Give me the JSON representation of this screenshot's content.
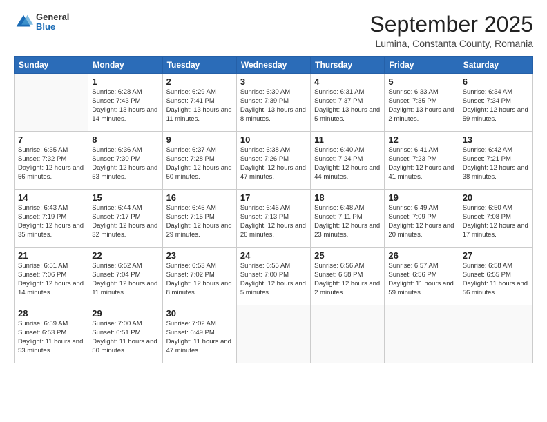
{
  "header": {
    "logo": {
      "general": "General",
      "blue": "Blue"
    },
    "title": "September 2025",
    "location": "Lumina, Constanta County, Romania"
  },
  "weekdays": [
    "Sunday",
    "Monday",
    "Tuesday",
    "Wednesday",
    "Thursday",
    "Friday",
    "Saturday"
  ],
  "weeks": [
    [
      {
        "day": "",
        "info": ""
      },
      {
        "day": "1",
        "info": "Sunrise: 6:28 AM\nSunset: 7:43 PM\nDaylight: 13 hours\nand 14 minutes."
      },
      {
        "day": "2",
        "info": "Sunrise: 6:29 AM\nSunset: 7:41 PM\nDaylight: 13 hours\nand 11 minutes."
      },
      {
        "day": "3",
        "info": "Sunrise: 6:30 AM\nSunset: 7:39 PM\nDaylight: 13 hours\nand 8 minutes."
      },
      {
        "day": "4",
        "info": "Sunrise: 6:31 AM\nSunset: 7:37 PM\nDaylight: 13 hours\nand 5 minutes."
      },
      {
        "day": "5",
        "info": "Sunrise: 6:33 AM\nSunset: 7:35 PM\nDaylight: 13 hours\nand 2 minutes."
      },
      {
        "day": "6",
        "info": "Sunrise: 6:34 AM\nSunset: 7:34 PM\nDaylight: 12 hours\nand 59 minutes."
      }
    ],
    [
      {
        "day": "7",
        "info": "Sunrise: 6:35 AM\nSunset: 7:32 PM\nDaylight: 12 hours\nand 56 minutes."
      },
      {
        "day": "8",
        "info": "Sunrise: 6:36 AM\nSunset: 7:30 PM\nDaylight: 12 hours\nand 53 minutes."
      },
      {
        "day": "9",
        "info": "Sunrise: 6:37 AM\nSunset: 7:28 PM\nDaylight: 12 hours\nand 50 minutes."
      },
      {
        "day": "10",
        "info": "Sunrise: 6:38 AM\nSunset: 7:26 PM\nDaylight: 12 hours\nand 47 minutes."
      },
      {
        "day": "11",
        "info": "Sunrise: 6:40 AM\nSunset: 7:24 PM\nDaylight: 12 hours\nand 44 minutes."
      },
      {
        "day": "12",
        "info": "Sunrise: 6:41 AM\nSunset: 7:23 PM\nDaylight: 12 hours\nand 41 minutes."
      },
      {
        "day": "13",
        "info": "Sunrise: 6:42 AM\nSunset: 7:21 PM\nDaylight: 12 hours\nand 38 minutes."
      }
    ],
    [
      {
        "day": "14",
        "info": "Sunrise: 6:43 AM\nSunset: 7:19 PM\nDaylight: 12 hours\nand 35 minutes."
      },
      {
        "day": "15",
        "info": "Sunrise: 6:44 AM\nSunset: 7:17 PM\nDaylight: 12 hours\nand 32 minutes."
      },
      {
        "day": "16",
        "info": "Sunrise: 6:45 AM\nSunset: 7:15 PM\nDaylight: 12 hours\nand 29 minutes."
      },
      {
        "day": "17",
        "info": "Sunrise: 6:46 AM\nSunset: 7:13 PM\nDaylight: 12 hours\nand 26 minutes."
      },
      {
        "day": "18",
        "info": "Sunrise: 6:48 AM\nSunset: 7:11 PM\nDaylight: 12 hours\nand 23 minutes."
      },
      {
        "day": "19",
        "info": "Sunrise: 6:49 AM\nSunset: 7:09 PM\nDaylight: 12 hours\nand 20 minutes."
      },
      {
        "day": "20",
        "info": "Sunrise: 6:50 AM\nSunset: 7:08 PM\nDaylight: 12 hours\nand 17 minutes."
      }
    ],
    [
      {
        "day": "21",
        "info": "Sunrise: 6:51 AM\nSunset: 7:06 PM\nDaylight: 12 hours\nand 14 minutes."
      },
      {
        "day": "22",
        "info": "Sunrise: 6:52 AM\nSunset: 7:04 PM\nDaylight: 12 hours\nand 11 minutes."
      },
      {
        "day": "23",
        "info": "Sunrise: 6:53 AM\nSunset: 7:02 PM\nDaylight: 12 hours\nand 8 minutes."
      },
      {
        "day": "24",
        "info": "Sunrise: 6:55 AM\nSunset: 7:00 PM\nDaylight: 12 hours\nand 5 minutes."
      },
      {
        "day": "25",
        "info": "Sunrise: 6:56 AM\nSunset: 6:58 PM\nDaylight: 12 hours\nand 2 minutes."
      },
      {
        "day": "26",
        "info": "Sunrise: 6:57 AM\nSunset: 6:56 PM\nDaylight: 11 hours\nand 59 minutes."
      },
      {
        "day": "27",
        "info": "Sunrise: 6:58 AM\nSunset: 6:55 PM\nDaylight: 11 hours\nand 56 minutes."
      }
    ],
    [
      {
        "day": "28",
        "info": "Sunrise: 6:59 AM\nSunset: 6:53 PM\nDaylight: 11 hours\nand 53 minutes."
      },
      {
        "day": "29",
        "info": "Sunrise: 7:00 AM\nSunset: 6:51 PM\nDaylight: 11 hours\nand 50 minutes."
      },
      {
        "day": "30",
        "info": "Sunrise: 7:02 AM\nSunset: 6:49 PM\nDaylight: 11 hours\nand 47 minutes."
      },
      {
        "day": "",
        "info": ""
      },
      {
        "day": "",
        "info": ""
      },
      {
        "day": "",
        "info": ""
      },
      {
        "day": "",
        "info": ""
      }
    ]
  ]
}
